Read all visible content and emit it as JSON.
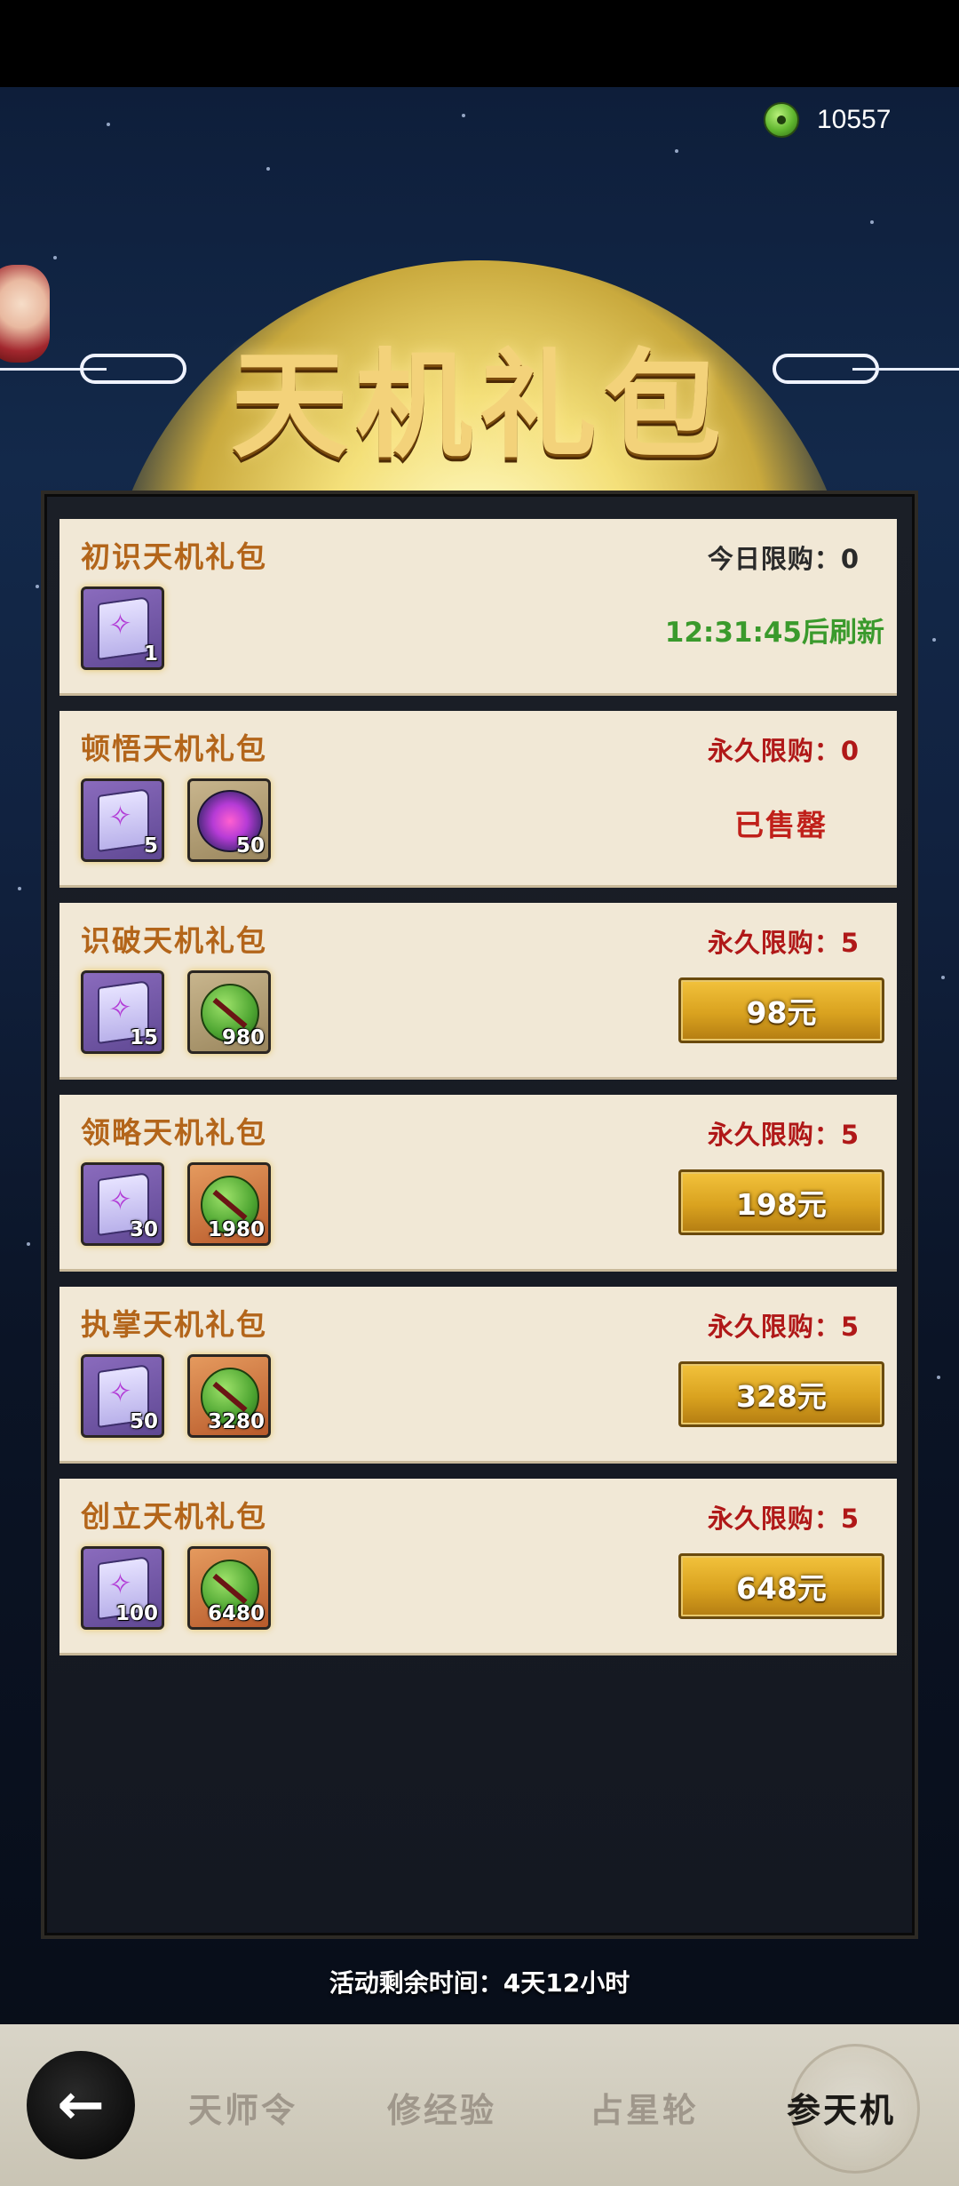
{
  "currency": {
    "icon": "jade-coin-icon",
    "value": "10557"
  },
  "title": "天机礼包",
  "packs": [
    {
      "name": "初识天机礼包",
      "limit": "今日限购：0",
      "status": "refresh",
      "refresh": "12:31:45后刷新",
      "items": [
        {
          "icon": "book-icon",
          "count": "1"
        }
      ]
    },
    {
      "name": "顿悟天机礼包",
      "limit": "永久限购：0",
      "status": "soldout",
      "soldout": "已售罄",
      "items": [
        {
          "icon": "book-icon",
          "count": "5"
        },
        {
          "icon": "medal-icon",
          "count": "50"
        }
      ]
    },
    {
      "name": "识破天机礼包",
      "limit": "永久限购：5",
      "status": "buy",
      "price": "98元",
      "items": [
        {
          "icon": "book-icon",
          "count": "15"
        },
        {
          "icon": "jade-icon",
          "count": "980"
        }
      ]
    },
    {
      "name": "领略天机礼包",
      "limit": "永久限购：5",
      "status": "buy",
      "price": "198元",
      "items": [
        {
          "icon": "book-icon",
          "count": "30"
        },
        {
          "icon": "jade-icon",
          "count": "1980"
        }
      ]
    },
    {
      "name": "执掌天机礼包",
      "limit": "永久限购：5",
      "status": "buy",
      "price": "328元",
      "items": [
        {
          "icon": "book-icon",
          "count": "50"
        },
        {
          "icon": "jade-icon",
          "count": "3280"
        }
      ]
    },
    {
      "name": "创立天机礼包",
      "limit": "永久限购：5",
      "status": "buy",
      "price": "648元",
      "items": [
        {
          "icon": "book-icon",
          "count": "100"
        },
        {
          "icon": "jade-icon",
          "count": "6480"
        }
      ]
    }
  ],
  "remaining_time": "活动剩余时间：4天12小时",
  "nav": {
    "back_icon": "back-arrow-icon",
    "tabs": [
      {
        "label": "天师令",
        "active": false
      },
      {
        "label": "修经验",
        "active": false
      },
      {
        "label": "占星轮",
        "active": false
      },
      {
        "label": "参天机",
        "active": true
      }
    ]
  }
}
